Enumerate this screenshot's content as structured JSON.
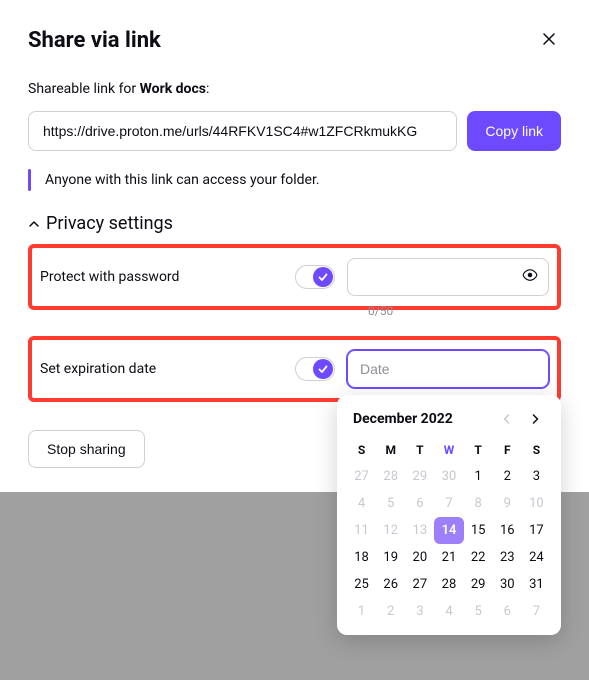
{
  "modal": {
    "title": "Share via link",
    "subhead_prefix": "Shareable link for ",
    "subhead_item": "Work docs",
    "subhead_suffix": ":",
    "link_value": "https://drive.proton.me/urls/44RFKV1SC4#w1ZFCRkmukKG",
    "copy_label": "Copy link",
    "info_text": "Anyone with this link can access your folder."
  },
  "privacy": {
    "heading": "Privacy settings",
    "password_label": "Protect with password",
    "password_counter": "0/50",
    "expiry_label": "Set expiration date",
    "expiry_placeholder": "Date",
    "stop_label": "Stop sharing"
  },
  "calendar": {
    "month_label": "December 2022",
    "dow": [
      "S",
      "M",
      "T",
      "W",
      "T",
      "F",
      "S"
    ],
    "today_col_index": 3,
    "days": [
      {
        "n": 27,
        "muted": true
      },
      {
        "n": 28,
        "muted": true
      },
      {
        "n": 29,
        "muted": true
      },
      {
        "n": 30,
        "muted": true
      },
      {
        "n": 1,
        "muted": false
      },
      {
        "n": 2,
        "muted": false
      },
      {
        "n": 3,
        "muted": false
      },
      {
        "n": 4,
        "muted": true
      },
      {
        "n": 5,
        "muted": true
      },
      {
        "n": 6,
        "muted": true
      },
      {
        "n": 7,
        "muted": true
      },
      {
        "n": 8,
        "muted": true
      },
      {
        "n": 9,
        "muted": true
      },
      {
        "n": 10,
        "muted": true
      },
      {
        "n": 11,
        "muted": true
      },
      {
        "n": 12,
        "muted": true
      },
      {
        "n": 13,
        "muted": true
      },
      {
        "n": 14,
        "today": true
      },
      {
        "n": 15
      },
      {
        "n": 16
      },
      {
        "n": 17
      },
      {
        "n": 18
      },
      {
        "n": 19
      },
      {
        "n": 20
      },
      {
        "n": 21
      },
      {
        "n": 22
      },
      {
        "n": 23
      },
      {
        "n": 24
      },
      {
        "n": 25
      },
      {
        "n": 26
      },
      {
        "n": 27
      },
      {
        "n": 28
      },
      {
        "n": 29
      },
      {
        "n": 30
      },
      {
        "n": 31
      },
      {
        "n": 1,
        "muted": true
      },
      {
        "n": 2,
        "muted": true
      },
      {
        "n": 3,
        "muted": true
      },
      {
        "n": 4,
        "muted": true
      },
      {
        "n": 5,
        "muted": true
      },
      {
        "n": 6,
        "muted": true
      },
      {
        "n": 7,
        "muted": true
      }
    ]
  }
}
